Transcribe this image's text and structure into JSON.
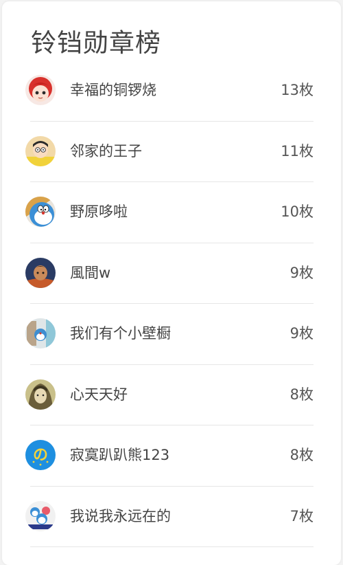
{
  "board": {
    "title": "铃铛勋章榜",
    "entries": [
      {
        "name": "幸福的铜锣烧",
        "count": "13枚",
        "avatar_icon": "red-hair-girl-avatar-icon"
      },
      {
        "name": "邻家的王子",
        "count": "11枚",
        "avatar_icon": "nobita-avatar-icon"
      },
      {
        "name": "野原哆啦",
        "count": "10枚",
        "avatar_icon": "doraemon-avatar-icon"
      },
      {
        "name": "風間w",
        "count": "9枚",
        "avatar_icon": "boy-avatar-icon"
      },
      {
        "name": "我们有个小壁橱",
        "count": "9枚",
        "avatar_icon": "doraemon-room-avatar-icon"
      },
      {
        "name": "心天天好",
        "count": "8枚",
        "avatar_icon": "sketch-girl-avatar-icon"
      },
      {
        "name": "寂寞趴趴熊123",
        "count": "8枚",
        "avatar_icon": "blue-logo-avatar-icon"
      },
      {
        "name": "我说我永远在的",
        "count": "7枚",
        "avatar_icon": "doraemon-group-avatar-icon"
      }
    ]
  },
  "colors": {
    "background": "#f3f3f3",
    "card": "#ffffff",
    "text": "#444444",
    "divider": "#e6e6e6",
    "blue_logo": "#1e8fe0"
  }
}
